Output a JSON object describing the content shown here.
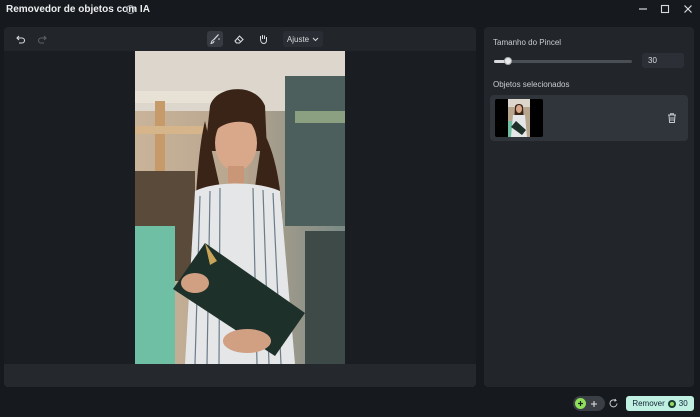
{
  "window": {
    "title": "Removedor de objetos com IA",
    "help_glyph": "?"
  },
  "toolbar": {
    "adjust_label": "Ajuste",
    "tools": [
      "undo-icon",
      "redo-icon",
      "brush-icon",
      "eraser-icon",
      "hand-icon"
    ]
  },
  "brush": {
    "size_label": "Tamanho do Pincel",
    "size_value": "30",
    "slider_fraction": 0.1
  },
  "objects": {
    "section_label": "Objetos selecionados"
  },
  "footer": {
    "remove_label": "Remover",
    "credits": "30"
  },
  "colors": {
    "accent": "#bff0e2",
    "toggle_on": "#8ee05a",
    "panel": "#22262b",
    "background": "#16191d"
  }
}
